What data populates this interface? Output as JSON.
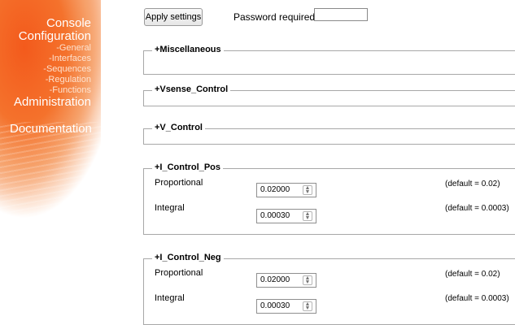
{
  "sidebar": {
    "console": "Console",
    "configuration": "Configuration",
    "sub_items": [
      "-General",
      "-Interfaces",
      "-Sequences",
      "-Regulation",
      "-Functions"
    ],
    "administration": "Administration",
    "documentation": "Documentation"
  },
  "toolbar": {
    "apply_label": "Apply settings",
    "password_label": "Password required:",
    "password_value": ""
  },
  "sections": {
    "misc": "+Miscellaneous",
    "vsense": "+Vsense_Control",
    "vctrl": "+V_Control",
    "ipos": {
      "title": "+I_Control_Pos",
      "proportional_label": "Proportional",
      "proportional_value": "0.02000",
      "proportional_default": "(default = 0.02)",
      "integral_label": "Integral",
      "integral_value": "0.00030",
      "integral_default": "(default = 0.0003)"
    },
    "ineg": {
      "title": "+I_Control_Neg",
      "proportional_label": "Proportional",
      "proportional_value": "0.02000",
      "proportional_default": "(default = 0.02)",
      "integral_label": "Integral",
      "integral_value": "0.00030",
      "integral_default": "(default = 0.0003)"
    }
  },
  "icons": {
    "spinner": "up-down-arrows-icon"
  },
  "colors": {
    "sidebar_orange": "#f35a1c"
  }
}
